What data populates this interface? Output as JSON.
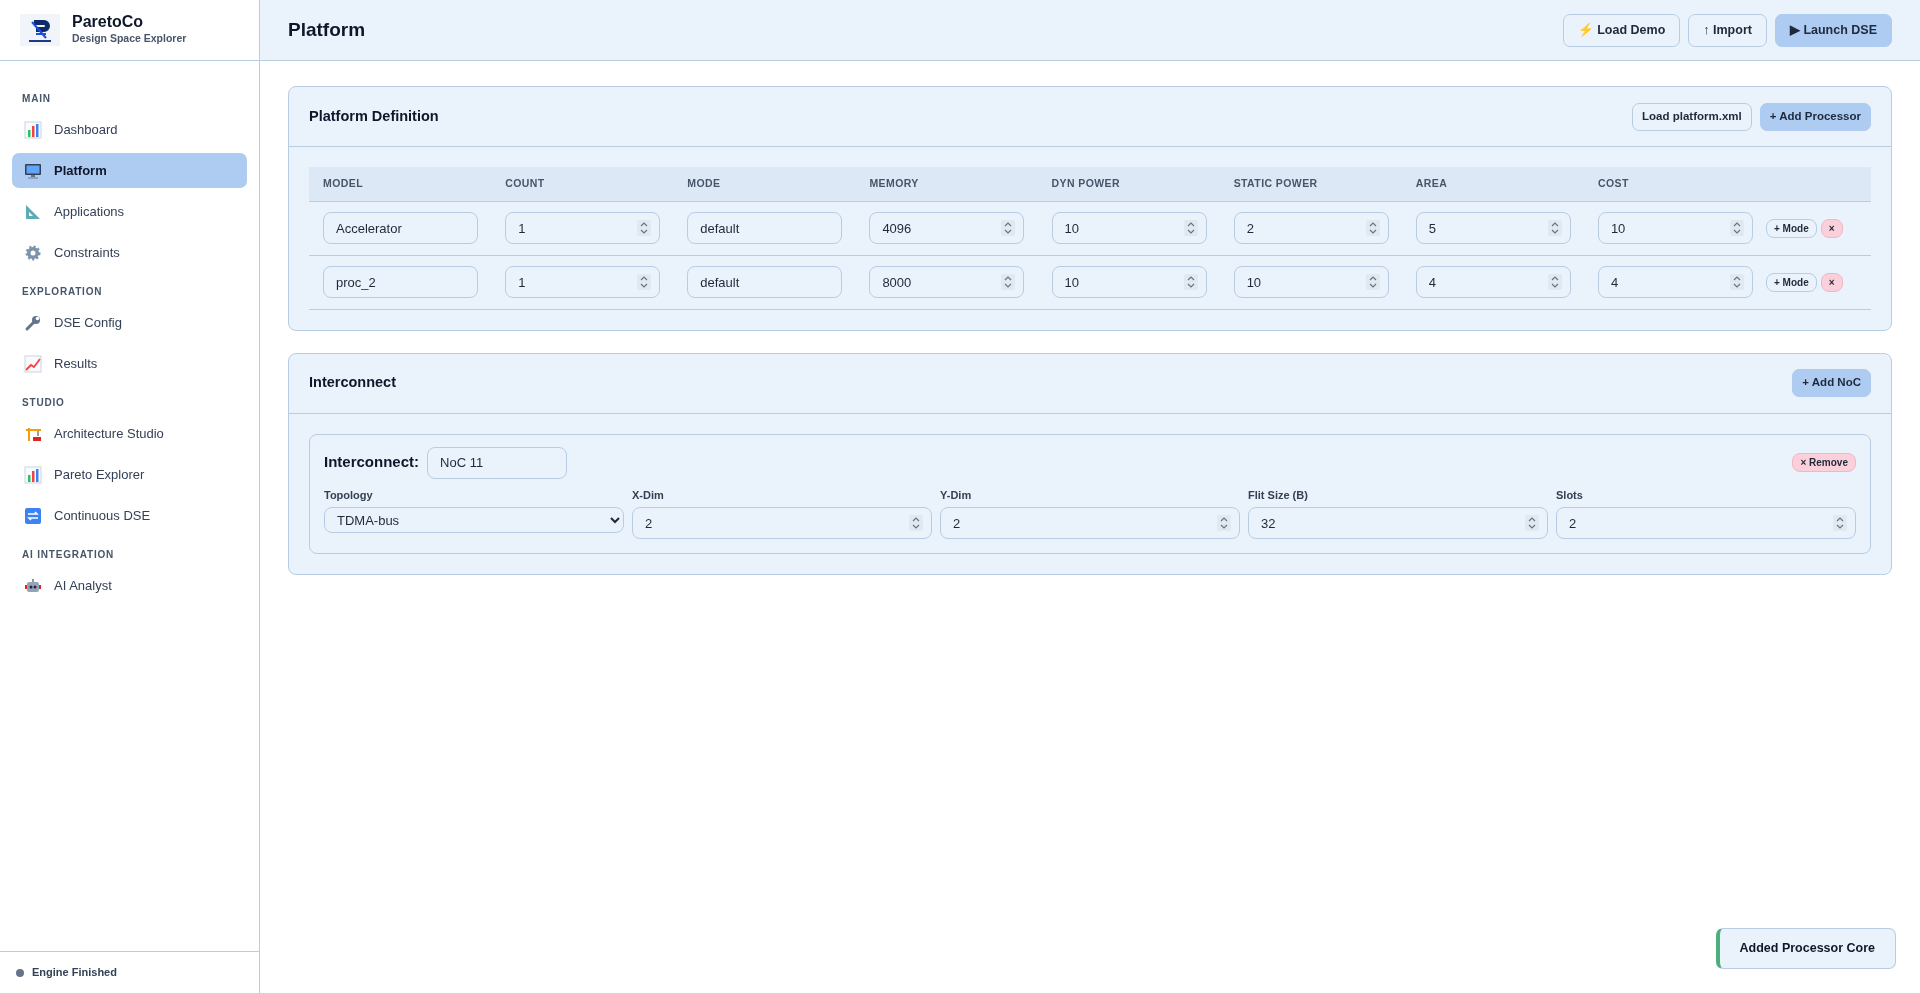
{
  "brand": {
    "name": "ParetoCo",
    "tagline": "Design Space Explorer"
  },
  "sidebar": {
    "sections": [
      {
        "title": "MAIN",
        "items": [
          {
            "label": "Dashboard",
            "selected": false
          },
          {
            "label": "Platform",
            "selected": true
          },
          {
            "label": "Applications",
            "selected": false
          },
          {
            "label": "Constraints",
            "selected": false
          }
        ]
      },
      {
        "title": "EXPLORATION",
        "items": [
          {
            "label": "DSE Config",
            "selected": false
          },
          {
            "label": "Results",
            "selected": false
          }
        ]
      },
      {
        "title": "STUDIO",
        "items": [
          {
            "label": "Architecture Studio",
            "selected": false
          },
          {
            "label": "Pareto Explorer",
            "selected": false
          },
          {
            "label": "Continuous DSE",
            "selected": false
          }
        ]
      },
      {
        "title": "AI INTEGRATION",
        "items": [
          {
            "label": "AI Analyst",
            "selected": false
          }
        ]
      }
    ],
    "status": {
      "label": "Engine Finished",
      "color": "#64748b"
    }
  },
  "header": {
    "title": "Platform",
    "buttons": [
      {
        "label": "⚡ Load Demo",
        "kind": "outline"
      },
      {
        "label": "↑ Import",
        "kind": "outline"
      },
      {
        "label": "▶ Launch DSE",
        "kind": "primary"
      }
    ]
  },
  "platform": {
    "title": "Platform Definition",
    "buttons": [
      {
        "label": "Load platform.xml",
        "kind": "outline"
      },
      {
        "label": "+ Add Processor",
        "kind": "primary"
      }
    ],
    "columns": [
      {
        "label": "MODEL",
        "kind": "text"
      },
      {
        "label": "COUNT",
        "kind": "number"
      },
      {
        "label": "MODE",
        "kind": "text"
      },
      {
        "label": "MEMORY",
        "kind": "number"
      },
      {
        "label": "DYN POWER",
        "kind": "number"
      },
      {
        "label": "STATIC POWER",
        "kind": "number"
      },
      {
        "label": "AREA",
        "kind": "number"
      },
      {
        "label": "COST",
        "kind": "number"
      }
    ],
    "rows": [
      {
        "cells": [
          "Accelerator",
          "1",
          "default",
          "4096",
          "10",
          "2",
          "5",
          "10"
        ],
        "add_mode": "+ Mode",
        "remove": "×"
      },
      {
        "cells": [
          "proc_2",
          "1",
          "default",
          "8000",
          "10",
          "10",
          "4",
          "4"
        ],
        "add_mode": "+ Mode",
        "remove": "×"
      }
    ]
  },
  "interconnect": {
    "title": "Interconnect",
    "add_button": "+ Add NoC",
    "noc": {
      "label": "Interconnect:",
      "name": "NoC 11",
      "remove": "× Remove",
      "fields": [
        {
          "label": "Topology",
          "kind": "select",
          "value": "TDMA-bus"
        },
        {
          "label": "X-Dim",
          "kind": "number",
          "value": "2"
        },
        {
          "label": "Y-Dim",
          "kind": "number",
          "value": "2"
        },
        {
          "label": "Flit Size (B)",
          "kind": "number",
          "value": "32"
        },
        {
          "label": "Slots",
          "kind": "number",
          "value": "2"
        }
      ]
    }
  },
  "toast": {
    "message": "Added Processor Core"
  }
}
